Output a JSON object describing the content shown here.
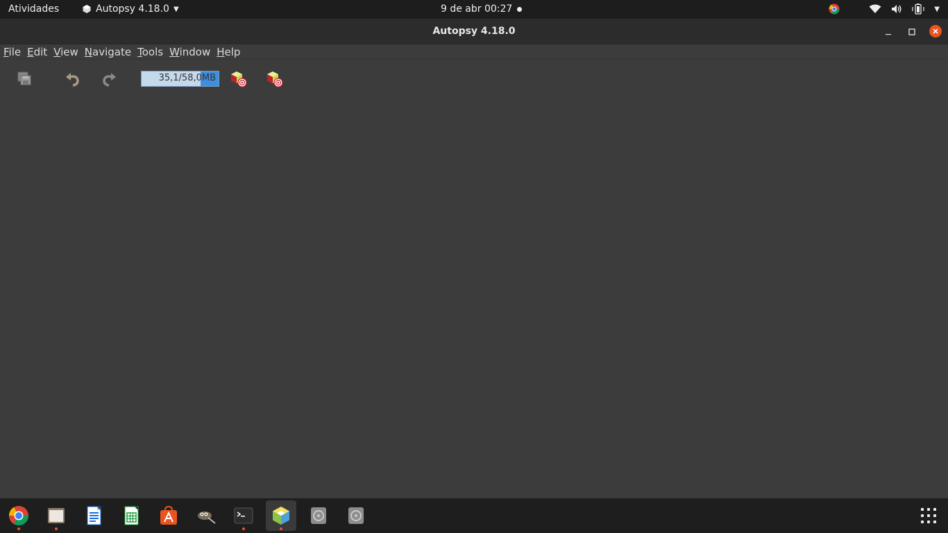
{
  "topbar": {
    "activities": "Atividades",
    "app_name": "Autopsy 4.18.0",
    "clock": "9 de abr  00:27",
    "tray_icons": [
      "chrome-icon",
      "wifi-icon",
      "volume-icon",
      "battery-icon",
      "chevron-down-icon"
    ]
  },
  "window": {
    "title": "Autopsy 4.18.0"
  },
  "menu": {
    "file": {
      "mnemonic": "F",
      "rest": "ile"
    },
    "edit": {
      "mnemonic": "E",
      "rest": "dit"
    },
    "view": {
      "mnemonic": "V",
      "rest": "iew"
    },
    "navigate": {
      "mnemonic": "N",
      "rest": "avigate"
    },
    "tools": {
      "mnemonic": "T",
      "rest": "ools"
    },
    "window": {
      "mnemonic": "W",
      "rest": "indow"
    },
    "help": {
      "mnemonic": "H",
      "rest": "elp"
    }
  },
  "toolbar": {
    "memory_label": "35,1/58,0MB",
    "memory_used_fraction": 0.605
  },
  "dock": {
    "apps": [
      "chrome",
      "files",
      "writer",
      "calc",
      "software",
      "gimp",
      "terminal",
      "autopsy",
      "disk-1",
      "disk-2"
    ]
  },
  "colors": {
    "accent": "#e95420",
    "memory_fill": "#3d8fe0",
    "background": "#3c3c3c"
  }
}
